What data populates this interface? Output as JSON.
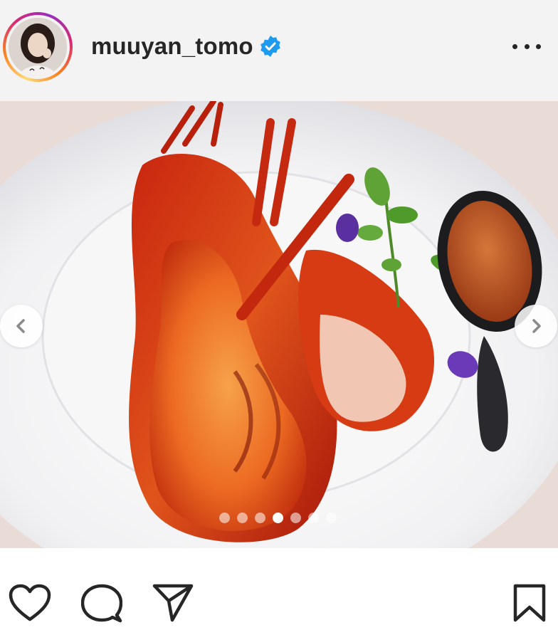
{
  "post": {
    "username": "muuyan_tomo",
    "verified": true,
    "avatar_icon": "profile-photo",
    "more_icon": "more-horizontal-icon"
  },
  "carousel": {
    "total_slides": 7,
    "active_index": 3,
    "prev_icon": "chevron-left-icon",
    "next_icon": "chevron-right-icon"
  },
  "actions": {
    "like_icon": "heart-icon",
    "comment_icon": "comment-icon",
    "share_icon": "send-icon",
    "save_icon": "bookmark-icon"
  },
  "colors": {
    "header_bg": "#f3f3f4",
    "text": "#262626",
    "verified": "#1d9bf0",
    "ring_start": "#feda75",
    "ring_end": "#962fbf"
  }
}
